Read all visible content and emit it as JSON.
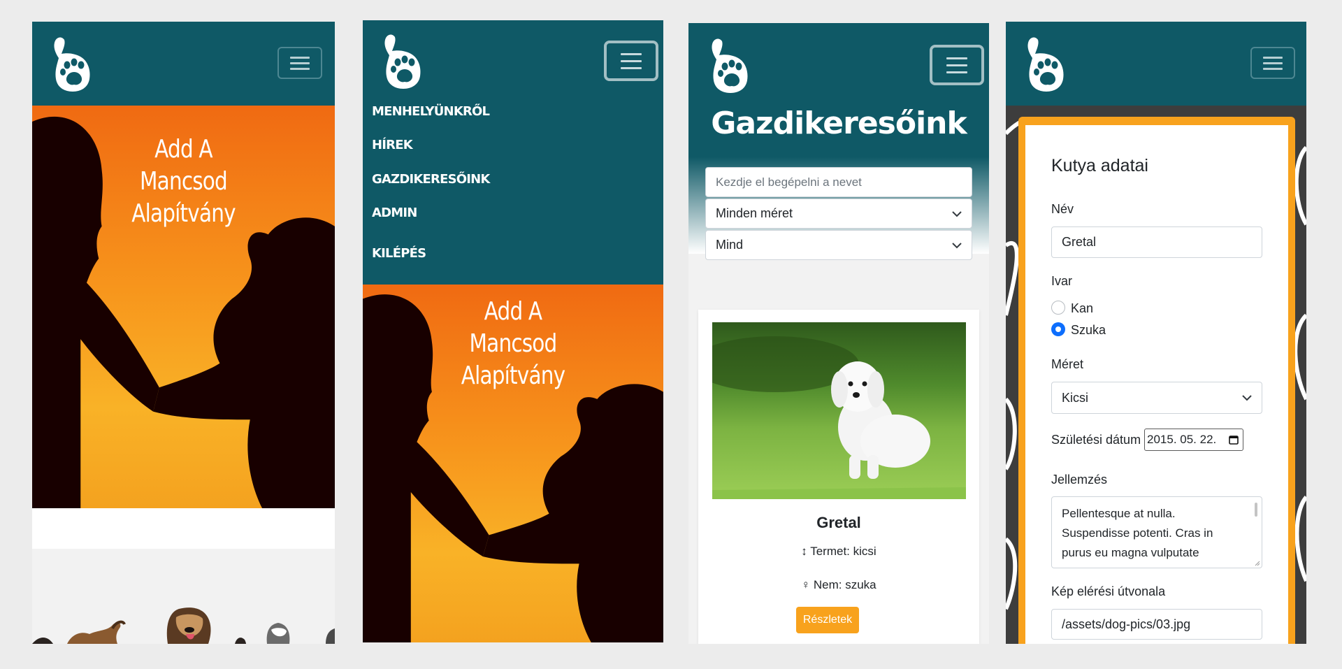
{
  "colors": {
    "navbar": "#0f5966",
    "background": "#ececec",
    "accent_orange": "#f8a21d",
    "radio_checked": "#0d6efd"
  },
  "brand": {
    "logo_icon": "hand-paw-icon"
  },
  "screen1": {
    "hero_title": [
      "Add A",
      "Mancsod",
      "Alapítvány"
    ]
  },
  "screen2": {
    "menu": [
      "MENHELYÜNKRŐL",
      "HÍREK",
      "GAZDIKERESŐINK",
      "ADMIN",
      "KILÉPÉS"
    ],
    "hero_title": [
      "Add A",
      "Mancsod",
      "Alapítvány"
    ]
  },
  "screen3": {
    "title": "Gazdikeresőink",
    "search_placeholder": "Kezdje el begépelni a nevet",
    "size_filter": "Minden méret",
    "gender_filter": "Mind",
    "card": {
      "name": "Gretal",
      "size": "Termet: kicsi",
      "gender": "Nem: szuka",
      "details_button": "Részletek"
    }
  },
  "screen4": {
    "heading": "Kutya adatai",
    "name_label": "Név",
    "name_value": "Gretal",
    "gender_label": "Ivar",
    "gender_options": [
      "Kan",
      "Szuka"
    ],
    "gender_selected": "Szuka",
    "size_label": "Méret",
    "size_value": "Kicsi",
    "birth_label": "Születési dátum",
    "birth_value": "2015. 05. 22.",
    "description_label": "Jellemzés",
    "description_value": "Pellentesque at nulla. Suspendisse potenti. Cras in purus eu magna vulputate",
    "image_path_label": "Kép elérési útvonala",
    "image_path_value": "/assets/dog-pics/03.jpg"
  }
}
